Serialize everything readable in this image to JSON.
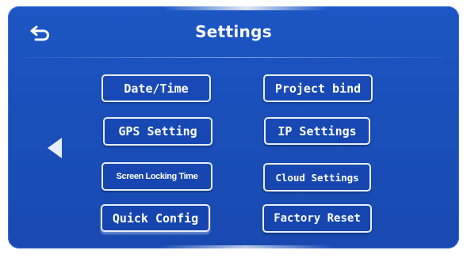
{
  "header": {
    "title": "Settings",
    "back_icon": "return-arrow-icon"
  },
  "nav": {
    "left_icon": "triangle-left-icon"
  },
  "buttons": {
    "date_time": "Date/Time",
    "project_bind": "Project bind",
    "gps_setting": "GPS Setting",
    "ip_settings": "IP Settings",
    "screen_locking_time": "Screen Locking Time",
    "cloud_settings": "Cloud Settings",
    "quick_config": "Quick Config",
    "factory_reset": "Factory Reset"
  },
  "colors": {
    "background": "#1a4fba",
    "button_border": "#e8eef8",
    "text": "#ffffff"
  }
}
